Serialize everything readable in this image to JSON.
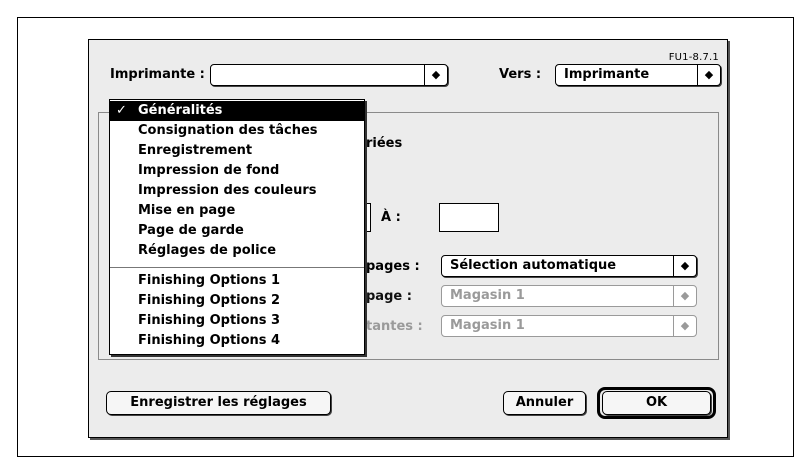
{
  "dialog": {
    "ref_code": "FU1-8.7.1",
    "printer_label": "Imprimante :",
    "printer_value": "",
    "to_label": "Vers :",
    "to_value": "Imprimante",
    "partial": {
      "copies_suffix": "riées",
      "range_to_label": "À :",
      "pages_label": "pages :",
      "page_label": "page :",
      "remaining_label": "tantes :"
    },
    "paper_source_first": "Sélection automatique",
    "paper_source_page": "Magasin 1",
    "paper_source_remaining": "Magasin 1",
    "save_settings_label": "Enregistrer les réglages",
    "cancel_label": "Annuler",
    "ok_label": "OK"
  },
  "menu": {
    "checkmark": "✓",
    "items": [
      "Généralités",
      "Consignation des tâches",
      "Enregistrement",
      "Impression de fond",
      "Impression des couleurs",
      "Mise en page",
      "Page de garde",
      "Réglages de police",
      "Finishing Options 1",
      "Finishing Options 2",
      "Finishing Options 3",
      "Finishing Options 4"
    ],
    "selected_index": 0
  },
  "icons": {
    "popup_arrows": "up-down-arrows-icon"
  }
}
